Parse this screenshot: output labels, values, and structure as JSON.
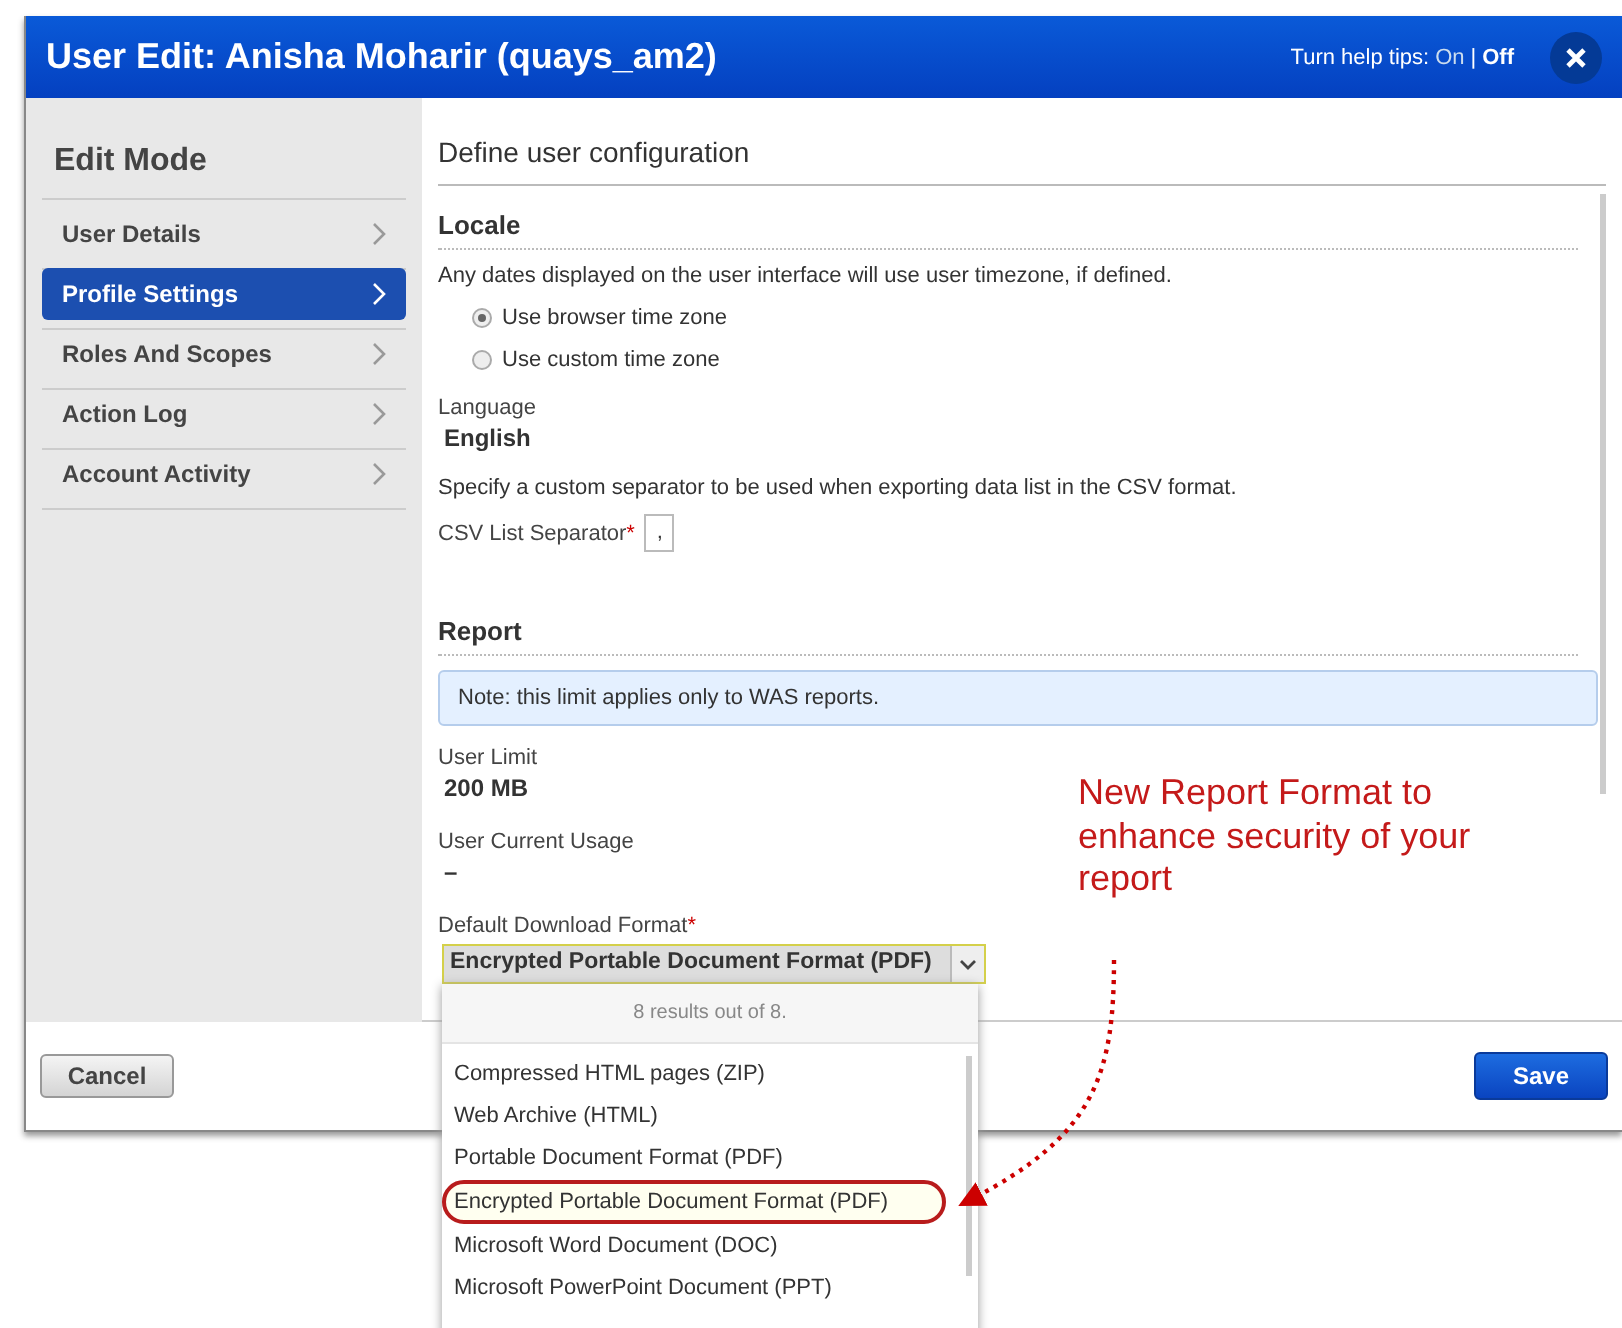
{
  "window": {
    "title": "User Edit: Anisha Moharir (quays_am2)"
  },
  "help_tips": {
    "label": "Turn help tips:",
    "separator": "|",
    "options": [
      {
        "label": "On",
        "selected": false
      },
      {
        "label": "Off",
        "selected": true
      }
    ]
  },
  "sidebar": {
    "title": "Edit Mode",
    "items": [
      {
        "label": "User Details",
        "selected": false
      },
      {
        "label": "Profile Settings",
        "selected": true
      },
      {
        "label": "Roles And Scopes",
        "selected": false
      },
      {
        "label": "Action Log",
        "selected": false
      },
      {
        "label": "Account Activity",
        "selected": false
      }
    ]
  },
  "content": {
    "heading": "Define user configuration",
    "locale": {
      "title": "Locale",
      "description": "Any dates displayed on the user interface will use user timezone, if defined.",
      "timezone_options": [
        {
          "label": "Use browser time zone",
          "selected": true
        },
        {
          "label": "Use custom time zone",
          "selected": false
        }
      ],
      "language_label": "Language",
      "language_value": "English",
      "separator_description": "Specify a custom separator to be used when exporting data list in the CSV format.",
      "separator_label": "CSV List Separator",
      "required_mark": "*",
      "separator_value": ","
    },
    "report": {
      "title": "Report",
      "note": "Note: this limit applies only to WAS reports.",
      "user_limit_label": "User Limit",
      "user_limit_value": "200 MB",
      "usage_label": "User Current Usage",
      "usage_value": "–",
      "format_label": "Default Download Format",
      "required_mark": "*",
      "format_value": "Encrypted Portable Document Format (PDF)",
      "dropdown": {
        "count": "8 results out of 8.",
        "options": [
          {
            "label": "Compressed HTML pages (ZIP)",
            "selected": false
          },
          {
            "label": "Web Archive (HTML)",
            "selected": false
          },
          {
            "label": "Portable Document Format (PDF)",
            "selected": false
          },
          {
            "label": "Encrypted Portable Document Format (PDF)",
            "selected": true
          },
          {
            "label": "Microsoft Word Document (DOC)",
            "selected": false
          },
          {
            "label": "Microsoft PowerPoint Document (PPT)",
            "selected": false
          }
        ]
      }
    }
  },
  "annotation": {
    "text": "New Report Format to enhance security of your report"
  },
  "buttons": {
    "cancel": "Cancel",
    "save": "Save"
  }
}
